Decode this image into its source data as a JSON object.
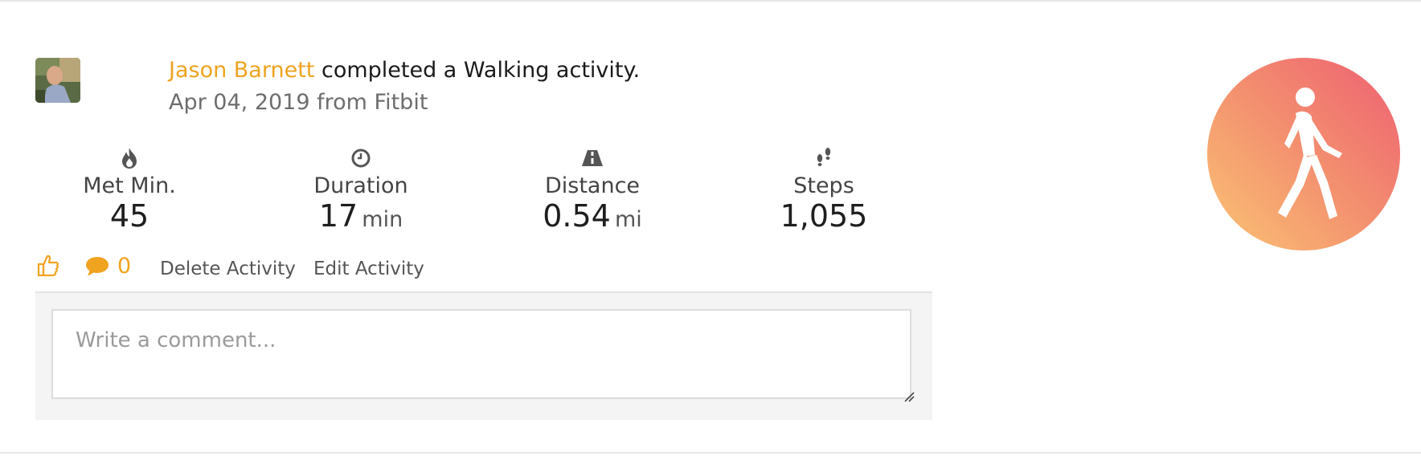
{
  "post": {
    "author": "Jason Barnett",
    "action_text": " completed a Walking activity.",
    "date": "Apr 04, 2019",
    "source_prefix": " from ",
    "source": "Fitbit"
  },
  "stats": [
    {
      "icon": "flame-icon",
      "label": "Met Min.",
      "value": "45",
      "unit": ""
    },
    {
      "icon": "clock-icon",
      "label": "Duration",
      "value": "17",
      "unit": "min"
    },
    {
      "icon": "road-icon",
      "label": "Distance",
      "value": "0.54",
      "unit": "mi"
    },
    {
      "icon": "footprints-icon",
      "label": "Steps",
      "value": "1,055",
      "unit": ""
    }
  ],
  "actions": {
    "like_icon": "thumbs-up-icon",
    "comment_icon": "speech-bubble-icon",
    "comment_count": "0",
    "delete_label": "Delete Activity",
    "edit_label": "Edit Activity"
  },
  "comment": {
    "placeholder": "Write a comment...",
    "value": ""
  },
  "activity_badge": {
    "icon": "walking-person-icon",
    "gradient_start": "#fbc474",
    "gradient_end": "#ee5f72"
  },
  "colors": {
    "accent": "#efa31f",
    "text": "#1a1a1a",
    "muted": "#6d6d6d"
  }
}
